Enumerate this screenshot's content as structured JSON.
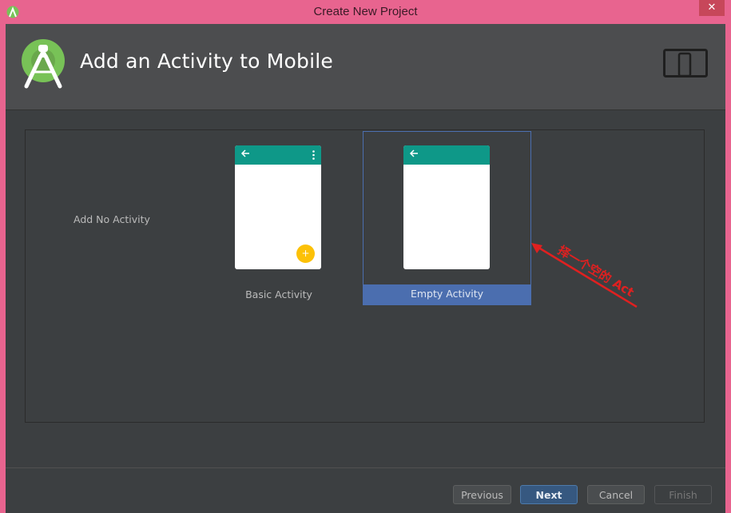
{
  "window": {
    "title": "Create New Project",
    "close_glyph": "✕",
    "app_icon": "android-studio-icon"
  },
  "header": {
    "title": "Add an Activity to Mobile",
    "logo_icon": "android-studio-logo-icon",
    "form_factor_icon": "phone-tablet-icon"
  },
  "gallery": {
    "no_activity_label": "Add No Activity",
    "templates": [
      {
        "label": "Basic Activity",
        "selected": false,
        "fab_glyph": "+"
      },
      {
        "label": "Empty Activity",
        "selected": true
      }
    ]
  },
  "annotation": {
    "text": "择一个空的 Act",
    "color": "#e02020"
  },
  "buttons": {
    "previous": "Previous",
    "next": "Next",
    "cancel": "Cancel",
    "finish": "Finish"
  },
  "colors": {
    "titlebar": "#e8648f",
    "selection": "#4b6eaf",
    "toolbar_teal": "#0e9888",
    "fab": "#fcc107"
  }
}
